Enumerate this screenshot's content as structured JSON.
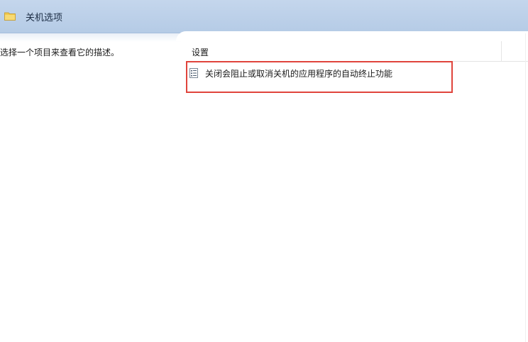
{
  "header": {
    "title": "关机选项",
    "icon": "folder-icon"
  },
  "description_pane": {
    "text": "选择一个项目来查看它的描述。"
  },
  "settings_list": {
    "column_header": "设置",
    "items": [
      {
        "label": "关闭会阻止或取消关机的应用程序的自动终止功能",
        "icon": "policy-setting-icon",
        "highlighted": true
      }
    ]
  },
  "colors": {
    "header_blue": "#b5cbe6",
    "highlight_red": "#e0443c",
    "folder_yellow": "#f2c94c"
  }
}
